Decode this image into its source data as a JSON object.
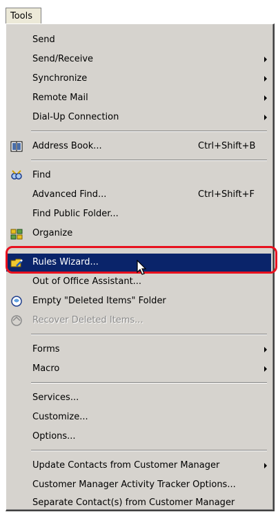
{
  "menubar": {
    "title": "Tools"
  },
  "items": [
    {
      "label": "Send"
    },
    {
      "label": "Send/Receive"
    },
    {
      "label": "Synchronize"
    },
    {
      "label": "Remote Mail"
    },
    {
      "label": "Dial-Up Connection"
    },
    {
      "label": "Address Book...",
      "shortcut": "Ctrl+Shift+B",
      "icon": "address-book-icon"
    },
    {
      "label": "Find",
      "icon": "find-icon"
    },
    {
      "label": "Advanced Find...",
      "shortcut": "Ctrl+Shift+F"
    },
    {
      "label": "Find Public Folder..."
    },
    {
      "label": "Organize",
      "icon": "organize-icon"
    },
    {
      "label": "Rules Wizard...",
      "icon": "rules-wizard-icon",
      "state": "highlighted"
    },
    {
      "label": "Out of Office Assistant..."
    },
    {
      "label": "Empty \"Deleted Items\" Folder",
      "icon": "empty-deleted-items-icon"
    },
    {
      "label": "Recover Deleted Items...",
      "icon": "recover-deleted-items-icon",
      "state": "disabled"
    },
    {
      "label": "Forms"
    },
    {
      "label": "Macro"
    },
    {
      "label": "Services..."
    },
    {
      "label": "Customize..."
    },
    {
      "label": "Options..."
    },
    {
      "label": "Update Contacts from Customer Manager"
    },
    {
      "label": "Customer Manager Activity Tracker Options..."
    },
    {
      "label": "Separate Contact(s) from Customer Manager"
    }
  ],
  "colors": {
    "menu_bg": "#d6d3ce",
    "highlight_bg": "#0a246a",
    "callout": "#e8101e"
  }
}
